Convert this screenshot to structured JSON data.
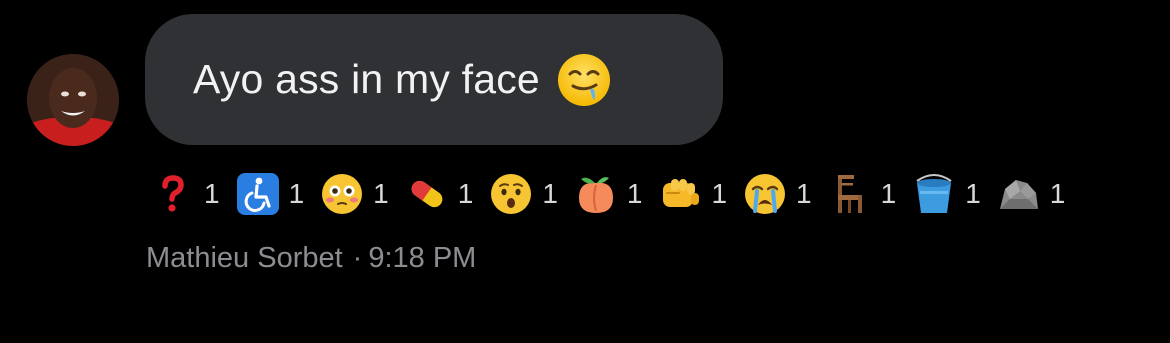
{
  "message": {
    "text": "Ayo ass in my face",
    "emoji_icon": "drooling-face-emoji",
    "bubble_color": "#2f3134"
  },
  "reactions": [
    {
      "icon": "red-question-mark-emoji",
      "count": "1"
    },
    {
      "icon": "wheelchair-symbol-emoji",
      "count": "1"
    },
    {
      "icon": "flushed-face-emoji",
      "count": "1"
    },
    {
      "icon": "pill-emoji",
      "count": "1"
    },
    {
      "icon": "hushed-face-emoji",
      "count": "1"
    },
    {
      "icon": "peach-emoji",
      "count": "1"
    },
    {
      "icon": "oncoming-fist-emoji",
      "count": "1"
    },
    {
      "icon": "crying-face-emoji",
      "count": "1"
    },
    {
      "icon": "chair-emoji",
      "count": "1"
    },
    {
      "icon": "bucket-emoji",
      "count": "1"
    },
    {
      "icon": "rock-emoji",
      "count": "1"
    }
  ],
  "footer": {
    "sender": "Mathieu Sorbet",
    "separator": "·",
    "time": "9:18 PM"
  }
}
